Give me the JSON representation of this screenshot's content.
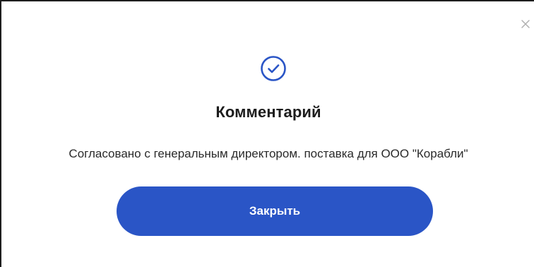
{
  "dialog": {
    "title": "Комментарий",
    "message": "Согласовано с генеральным директором. поставка для ООО \"Корабли\"",
    "close_button_label": "Закрыть",
    "icons": {
      "status": "check-circle-icon",
      "dismiss": "close-icon"
    }
  },
  "colors": {
    "accent": "#2a55c6",
    "title_text": "#1c1c1c",
    "body_text": "#2a2a2a",
    "close_icon": "#b0b0b0"
  }
}
